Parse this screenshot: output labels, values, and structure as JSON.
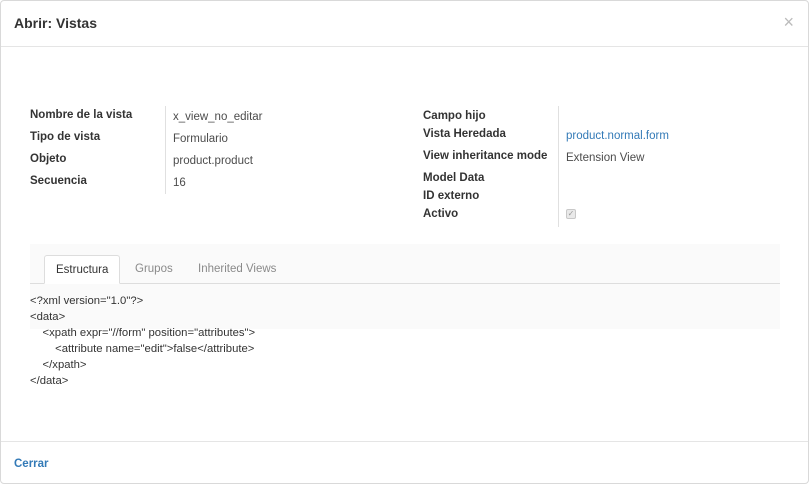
{
  "dialog": {
    "title": "Abrir: Vistas",
    "close_symbol": "×"
  },
  "left_fields": [
    {
      "label": "Nombre de la vista",
      "value": "x_view_no_editar"
    },
    {
      "label": "Tipo de vista",
      "value": "Formulario"
    },
    {
      "label": "Objeto",
      "value": "product.product"
    },
    {
      "label": "Secuencia",
      "value": "16"
    }
  ],
  "right_fields": {
    "campo_hijo": {
      "label": "Campo hijo",
      "value": ""
    },
    "vista_heredada": {
      "label": "Vista Heredada",
      "value": "product.normal.form"
    },
    "inheritance_mode": {
      "label": "View inheritance mode",
      "value": "Extension View"
    },
    "model_data": {
      "label": "Model Data",
      "value": ""
    },
    "id_externo": {
      "label": "ID externo",
      "value": ""
    },
    "activo": {
      "label": "Activo",
      "checked": true,
      "check_symbol": "✓"
    }
  },
  "tabs": [
    {
      "label": "Estructura",
      "active": true
    },
    {
      "label": "Grupos",
      "active": false
    },
    {
      "label": "Inherited Views",
      "active": false
    }
  ],
  "arch_lines": [
    "<?xml version=\"1.0\"?>",
    "<data>",
    "    <xpath expr=\"//form\" position=\"attributes\">",
    "        <attribute name=\"edit\">false</attribute>",
    "    </xpath>",
    "</data>"
  ],
  "footer": {
    "close_label": "Cerrar"
  },
  "colors": {
    "link": "#337ab7",
    "label": "#333333",
    "muted": "#8a8a8a"
  }
}
